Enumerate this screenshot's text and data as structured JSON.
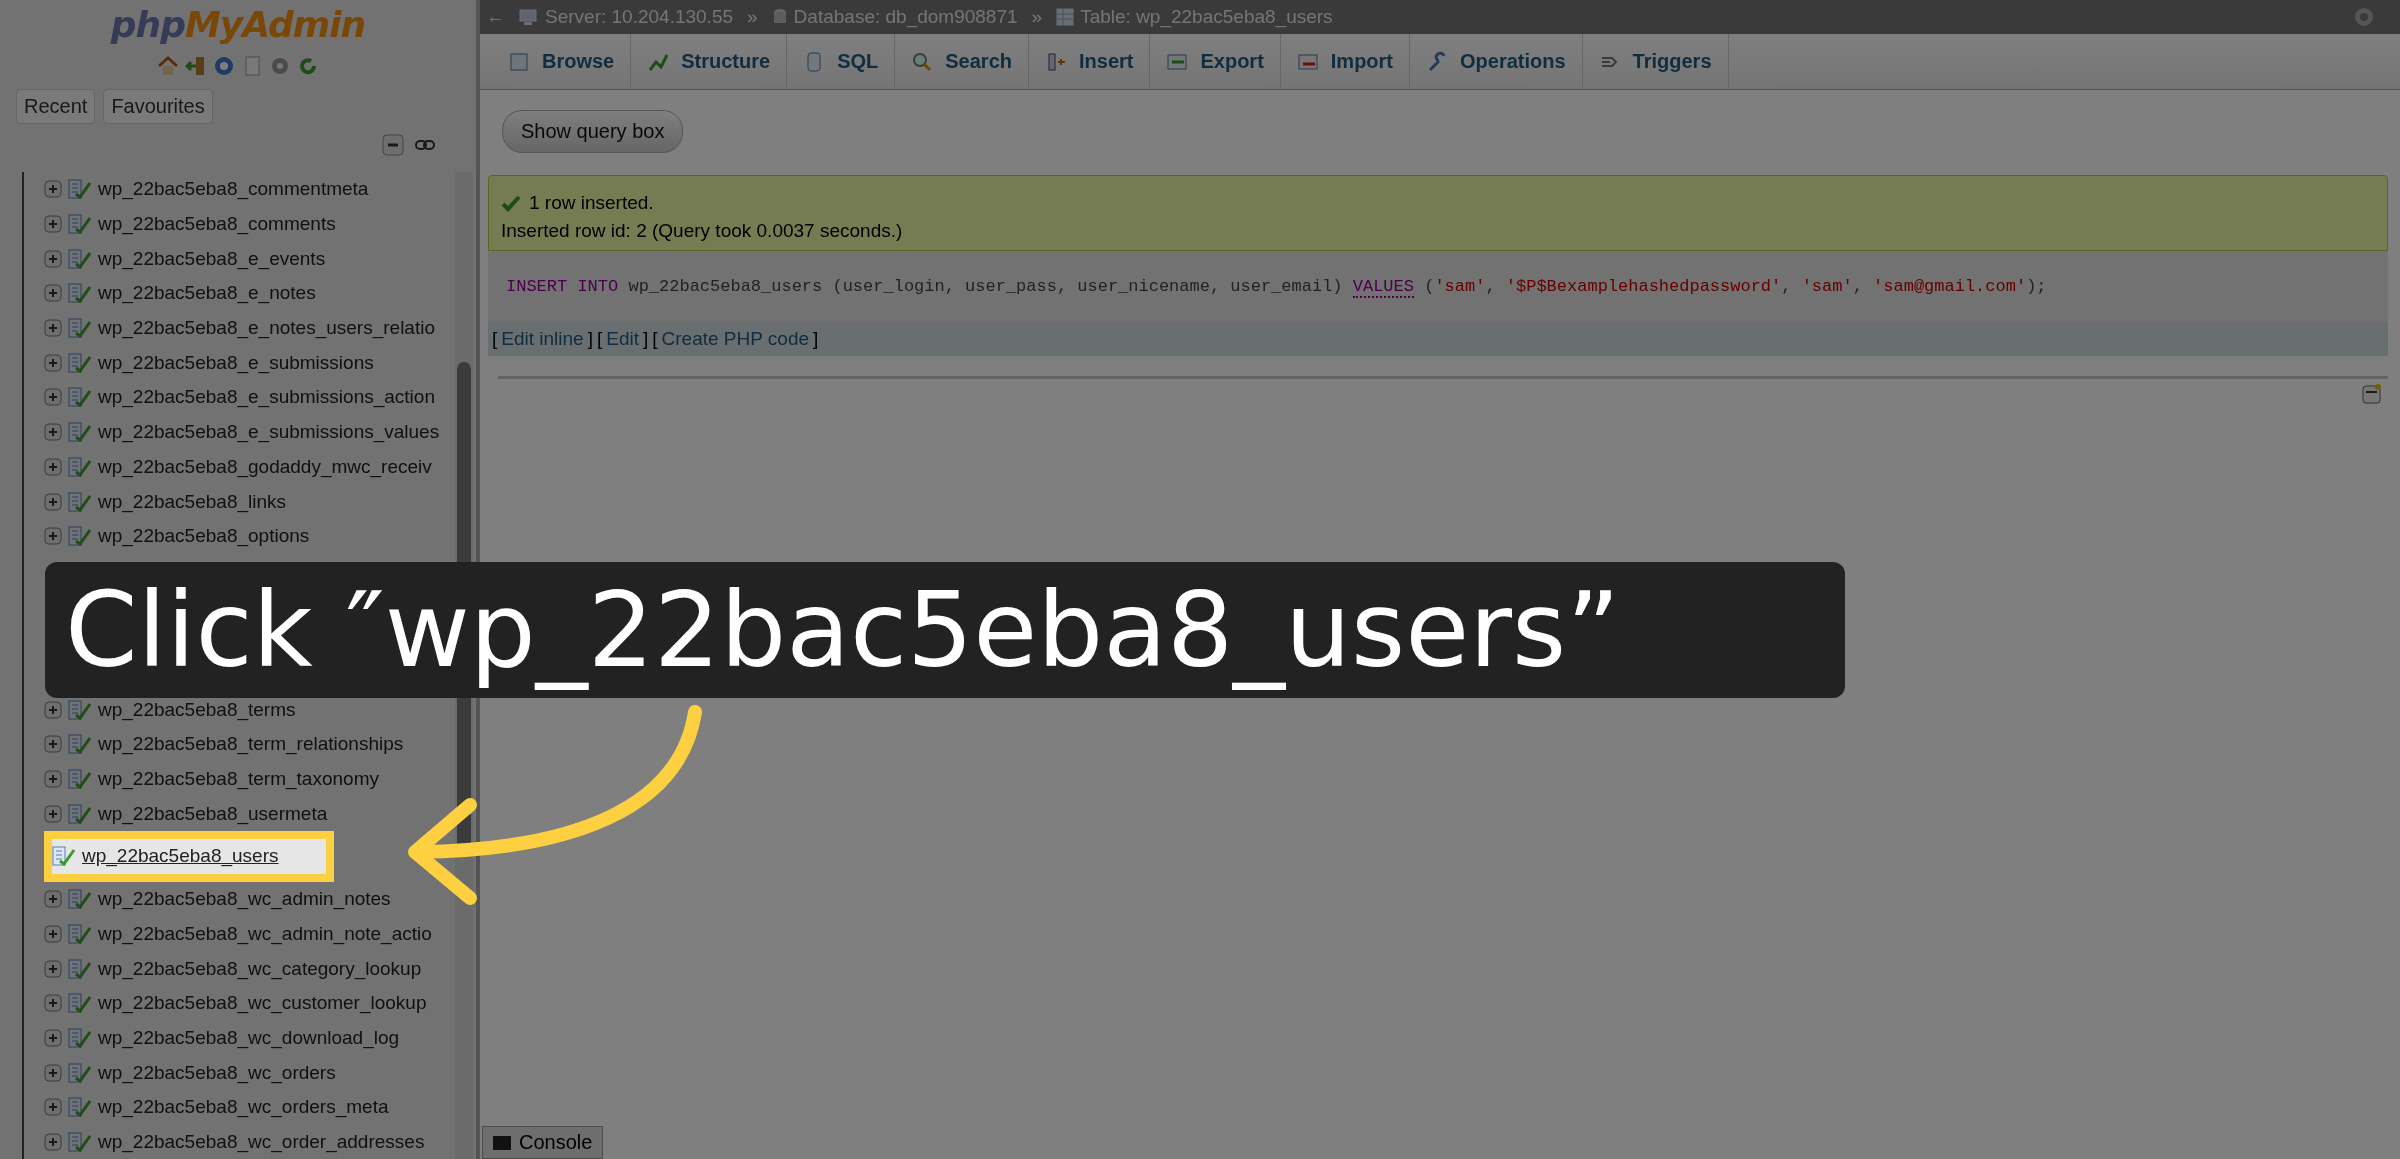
{
  "sidebar": {
    "logo": {
      "first": "php",
      "second": "MyAdmin"
    },
    "tabs": [
      {
        "label": "Recent"
      },
      {
        "label": "Favourites"
      }
    ],
    "tree_above": [
      {
        "label": "wp_22bac5eba8_commentmeta",
        "selected": false
      },
      {
        "label": "wp_22bac5eba8_comments",
        "selected": false
      },
      {
        "label": "wp_22bac5eba8_e_events",
        "selected": false
      },
      {
        "label": "wp_22bac5eba8_e_notes",
        "selected": false
      },
      {
        "label": "wp_22bac5eba8_e_notes_users_relatio",
        "selected": false
      },
      {
        "label": "wp_22bac5eba8_e_submissions",
        "selected": false
      },
      {
        "label": "wp_22bac5eba8_e_submissions_action",
        "selected": false
      },
      {
        "label": "wp_22bac5eba8_e_submissions_values",
        "selected": false
      },
      {
        "label": "wp_22bac5eba8_godaddy_mwc_receiv",
        "selected": false
      },
      {
        "label": "wp_22bac5eba8_links",
        "selected": false
      },
      {
        "label": "wp_22bac5eba8_options",
        "selected": false
      }
    ],
    "tree_below": [
      {
        "label": "wp_22bac5eba8_terms",
        "selected": false
      },
      {
        "label": "wp_22bac5eba8_term_relationships",
        "selected": false
      },
      {
        "label": "wp_22bac5eba8_term_taxonomy",
        "selected": false
      },
      {
        "label": "wp_22bac5eba8_usermeta",
        "selected": false
      },
      {
        "label": "wp_22bac5eba8_users",
        "selected": true
      },
      {
        "label": "wp_22bac5eba8_wc_admin_notes",
        "selected": false
      },
      {
        "label": "wp_22bac5eba8_wc_admin_note_actio",
        "selected": false
      },
      {
        "label": "wp_22bac5eba8_wc_category_lookup",
        "selected": false
      },
      {
        "label": "wp_22bac5eba8_wc_customer_lookup",
        "selected": false
      },
      {
        "label": "wp_22bac5eba8_wc_download_log",
        "selected": false
      },
      {
        "label": "wp_22bac5eba8_wc_orders",
        "selected": false
      },
      {
        "label": "wp_22bac5eba8_wc_orders_meta",
        "selected": false
      },
      {
        "label": "wp_22bac5eba8_wc_order_addresses",
        "selected": false
      }
    ]
  },
  "back": "←",
  "breadcrumb": [
    {
      "kind": "server",
      "label": "Server: 10.204.130.55"
    },
    {
      "kind": "database",
      "separator": "»",
      "label": "Database: db_dom908871"
    },
    {
      "kind": "table",
      "separator": "»",
      "label": "Table: wp_22bac5eba8_users"
    }
  ],
  "tabs": [
    {
      "label": "Browse"
    },
    {
      "label": "Structure"
    },
    {
      "label": "SQL"
    },
    {
      "label": "Search"
    },
    {
      "label": "Insert"
    },
    {
      "label": "Export"
    },
    {
      "label": "Import"
    },
    {
      "label": "Operations"
    },
    {
      "label": "Triggers"
    }
  ],
  "query_button": "Show query box",
  "message": {
    "title": "1 row inserted.",
    "detail": "Inserted row id: 2 (Query took 0.0037 seconds.)"
  },
  "sql": [
    {
      "kind": "keyword",
      "text": "INSERT"
    },
    {
      "kind": "keyword",
      "text": " INTO"
    },
    {
      "kind": "plain",
      "text": " wp_22bac5eba8_users (user_login, user_pass, user_nicename, user_email) "
    },
    {
      "kind": "keyword2",
      "text": "VALUES"
    },
    {
      "kind": "plain",
      "text": " ("
    },
    {
      "kind": "string",
      "text": "'sam'"
    },
    {
      "kind": "plain",
      "text": ", "
    },
    {
      "kind": "string",
      "text": "'$P$Bexamplehashedpassword'"
    },
    {
      "kind": "plain",
      "text": ", "
    },
    {
      "kind": "string",
      "text": "'sam'"
    },
    {
      "kind": "plain",
      "text": ", "
    },
    {
      "kind": "string",
      "text": "'sam@gmail.com'"
    },
    {
      "kind": "plain",
      "text": ");"
    }
  ],
  "actions": [
    {
      "open": "[",
      "label": "Edit inline",
      "close": "]"
    },
    {
      "open": "[",
      "label": "Edit",
      "close": "]"
    },
    {
      "open": "[",
      "label": "Create PHP code",
      "close": "]"
    }
  ],
  "console": "Console",
  "callout": "Click ″wp_22bac5eba8_users”"
}
